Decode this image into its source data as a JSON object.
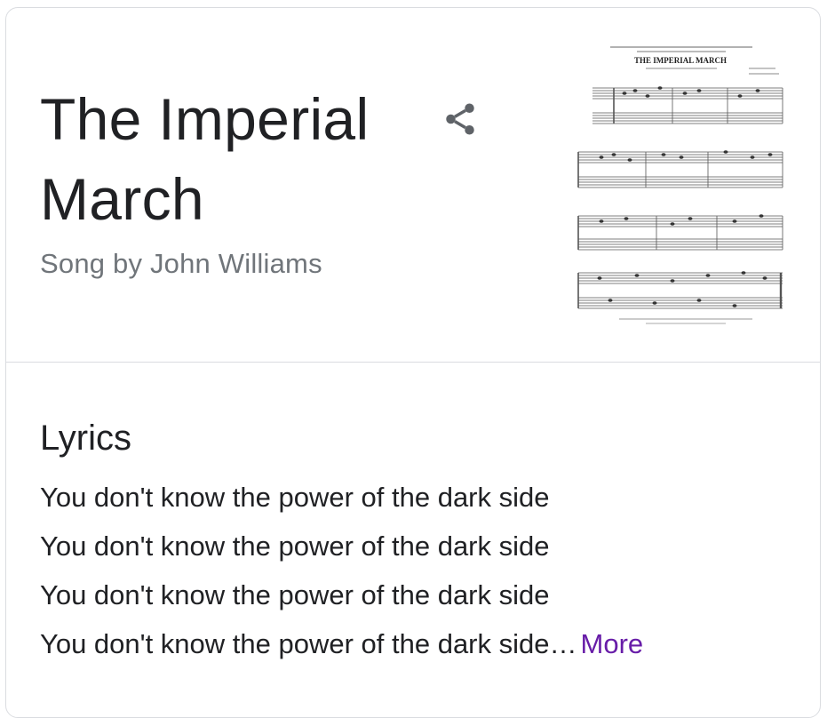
{
  "header": {
    "title": "The Imperial March",
    "subtitle": "Song by John Williams",
    "share_icon": "share-icon",
    "sheet_music_title": "THE IMPERIAL MARCH"
  },
  "lyrics": {
    "heading": "Lyrics",
    "lines": [
      "You don't know the power of the dark side",
      "You don't know the power of the dark side",
      "You don't know the power of the dark side",
      "You don't know the power of the dark side…"
    ],
    "more_label": "More"
  },
  "colors": {
    "text": "#202124",
    "secondary": "#70757a",
    "link_visited": "#681da8",
    "border": "#dadce0"
  }
}
